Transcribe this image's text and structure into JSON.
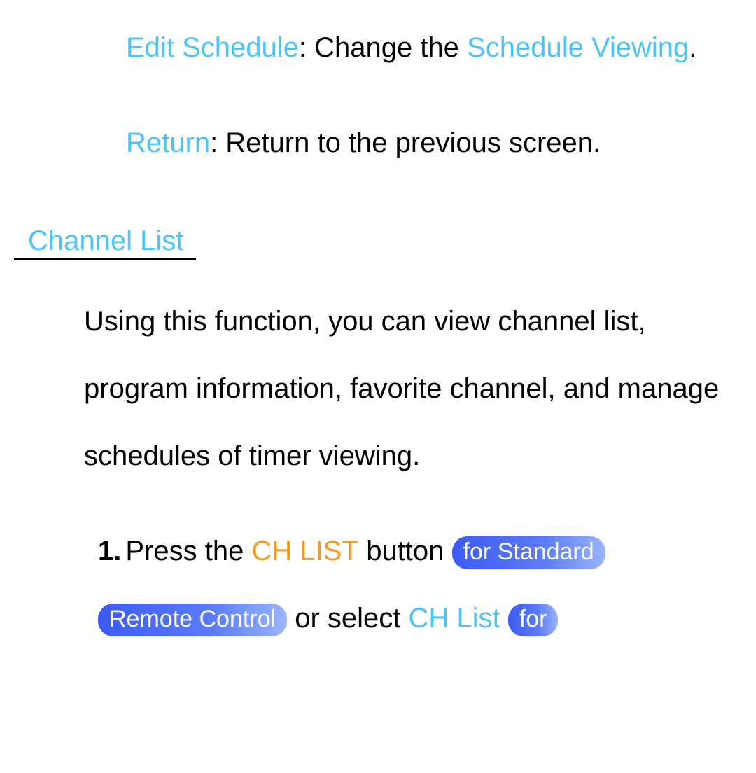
{
  "section1": {
    "editSchedule": {
      "label": "Edit Schedule",
      "sep": ": ",
      "textBefore": "Change the ",
      "scheduleViewing": "Schedule Viewing",
      "period": "."
    },
    "return": {
      "label": "Return",
      "sep": ": ",
      "text": "Return to the previous screen."
    }
  },
  "heading": "Channel List",
  "bodyPara": "Using this function, you can view channel list, program information, favorite channel, and manage schedules of timer viewing.",
  "step1": {
    "num": "1.",
    "t1": "Press the ",
    "chlist": "CH LIST",
    "t2": " button ",
    "pill1": "for Standard",
    "pill2": "Remote Control",
    "t3": " or select ",
    "chlist2": "CH List",
    "sp": " ",
    "pill3": "for"
  }
}
